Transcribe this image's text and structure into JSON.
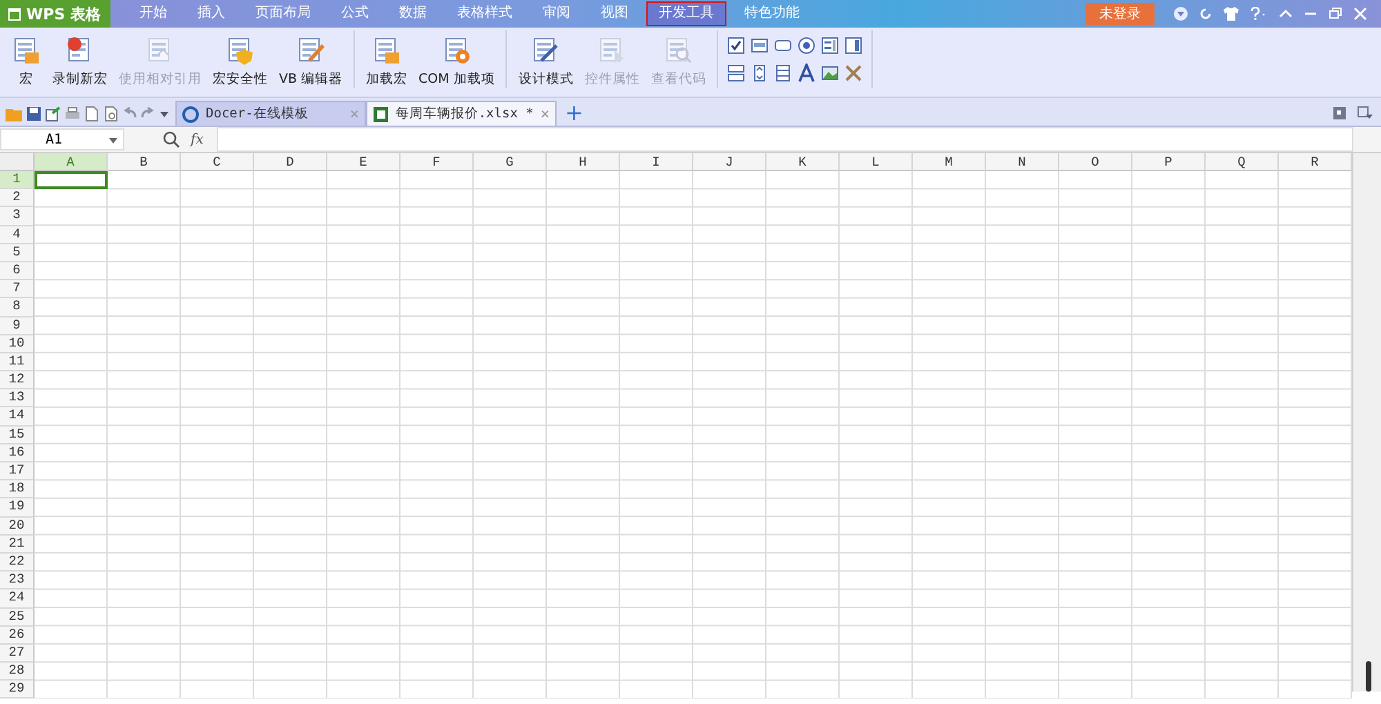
{
  "title_bar": {
    "logo": "WPS 表格",
    "login": "未登录"
  },
  "menu": [
    {
      "label": "开始",
      "selected": false
    },
    {
      "label": "插入",
      "selected": false
    },
    {
      "label": "页面布局",
      "selected": false
    },
    {
      "label": "公式",
      "selected": false
    },
    {
      "label": "数据",
      "selected": false
    },
    {
      "label": "表格样式",
      "selected": false
    },
    {
      "label": "审阅",
      "selected": false
    },
    {
      "label": "视图",
      "selected": false
    },
    {
      "label": "开发工具",
      "selected": true
    },
    {
      "label": "特色功能",
      "selected": false
    }
  ],
  "ribbon": {
    "groups": [
      [
        {
          "label": "宏",
          "kind": "macro",
          "disabled": false
        },
        {
          "label": "录制新宏",
          "kind": "record",
          "disabled": false
        },
        {
          "label": "使用相对引用",
          "kind": "relative",
          "disabled": true
        },
        {
          "label": "宏安全性",
          "kind": "security",
          "disabled": false
        },
        {
          "label": "VB 编辑器",
          "kind": "editor",
          "disabled": false
        }
      ],
      [
        {
          "label": "加载宏",
          "kind": "macro",
          "disabled": false
        },
        {
          "label": "COM 加载项",
          "kind": "com",
          "disabled": false
        }
      ],
      [
        {
          "label": "设计模式",
          "kind": "design",
          "disabled": false
        },
        {
          "label": "控件属性",
          "kind": "properties",
          "disabled": true
        },
        {
          "label": "查看代码",
          "kind": "code",
          "disabled": true
        }
      ]
    ]
  },
  "doc_tabs": [
    {
      "label": "Docer-在线模板",
      "kind": "docer",
      "selected": false,
      "close": "×"
    },
    {
      "label": "每周车辆报价.xlsx *",
      "kind": "sheet",
      "selected": true,
      "close": "×"
    }
  ],
  "new_tab": "+",
  "formula_bar": {
    "name_box": "A1",
    "fx": "fx"
  },
  "columns": [
    {
      "label": "A",
      "selected": true
    },
    {
      "label": "B",
      "selected": false
    },
    {
      "label": "C",
      "selected": false
    },
    {
      "label": "D",
      "selected": false
    },
    {
      "label": "E",
      "selected": false
    },
    {
      "label": "F",
      "selected": false
    },
    {
      "label": "G",
      "selected": false
    },
    {
      "label": "H",
      "selected": false
    },
    {
      "label": "I",
      "selected": false
    },
    {
      "label": "J",
      "selected": false
    },
    {
      "label": "K",
      "selected": false
    },
    {
      "label": "L",
      "selected": false
    },
    {
      "label": "M",
      "selected": false
    },
    {
      "label": "N",
      "selected": false
    },
    {
      "label": "O",
      "selected": false
    },
    {
      "label": "P",
      "selected": false
    },
    {
      "label": "Q",
      "selected": false
    },
    {
      "label": "R",
      "selected": false
    }
  ],
  "rows": [
    {
      "label": "1",
      "selected": true
    },
    {
      "label": "2",
      "selected": false
    },
    {
      "label": "3",
      "selected": false
    },
    {
      "label": "4",
      "selected": false
    },
    {
      "label": "5",
      "selected": false
    },
    {
      "label": "6",
      "selected": false
    },
    {
      "label": "7",
      "selected": false
    },
    {
      "label": "8",
      "selected": false
    },
    {
      "label": "9",
      "selected": false
    },
    {
      "label": "10",
      "selected": false
    },
    {
      "label": "11",
      "selected": false
    },
    {
      "label": "12",
      "selected": false
    },
    {
      "label": "13",
      "selected": false
    },
    {
      "label": "14",
      "selected": false
    },
    {
      "label": "15",
      "selected": false
    },
    {
      "label": "16",
      "selected": false
    },
    {
      "label": "17",
      "selected": false
    },
    {
      "label": "18",
      "selected": false
    },
    {
      "label": "19",
      "selected": false
    },
    {
      "label": "20",
      "selected": false
    },
    {
      "label": "21",
      "selected": false
    },
    {
      "label": "22",
      "selected": false
    },
    {
      "label": "23",
      "selected": false
    },
    {
      "label": "24",
      "selected": false
    },
    {
      "label": "25",
      "selected": false
    },
    {
      "label": "26",
      "selected": false
    },
    {
      "label": "27",
      "selected": false
    },
    {
      "label": "28",
      "selected": false
    },
    {
      "label": "29",
      "selected": false
    }
  ]
}
